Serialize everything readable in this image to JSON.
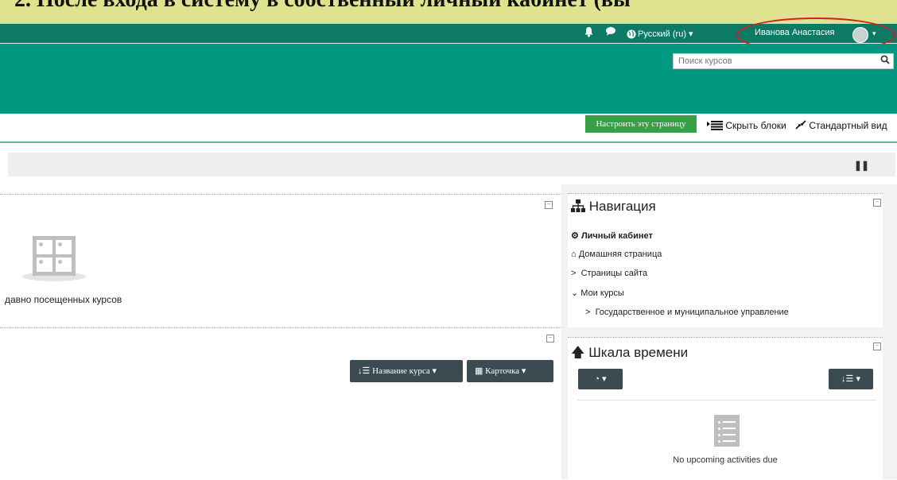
{
  "doc_strip": {
    "text": "2. После входа в систему в собственный личный кабинет (вы"
  },
  "navbar": {
    "bell_icon": "bell-icon",
    "chat_icon": "chat-icon",
    "language": "Русский (ru) ▾",
    "user_name": "Иванова Анастасия",
    "user_caret": "▾"
  },
  "header": {
    "search_placeholder": "Поиск курсов",
    "search_icon": "🔍"
  },
  "toolbar": {
    "customize_label": "Настроить эту страницу",
    "hide_blocks_label": "Скрыть блоки",
    "standard_view_label": "Стандартный вид"
  },
  "recent_courses": {
    "empty_text": "давно посещенных курсов"
  },
  "course_overview": {
    "sort_button": "Название курса",
    "view_button": "Карточка"
  },
  "navigation": {
    "title": "Навигация",
    "items": [
      {
        "label": "Личный кабинет",
        "icon": "dashboard-icon",
        "bold": true
      },
      {
        "label": "Домашняя страница",
        "icon": "home-icon"
      },
      {
        "label": "Страницы сайта",
        "icon": "chevron-right-icon"
      },
      {
        "label": "Мои курсы",
        "icon": "chevron-down-icon"
      },
      {
        "label": "Государственное и муниципальное управление",
        "icon": "chevron-right-icon"
      }
    ]
  },
  "timeline": {
    "title": "Шкала времени",
    "empty_text": "No upcoming activities due"
  },
  "colors": {
    "navbar": "#0d7a65",
    "header": "#009880",
    "customize_button": "#37a045",
    "dark_button": "#3c4b51",
    "annotation_ellipse": "#d71c1c"
  }
}
